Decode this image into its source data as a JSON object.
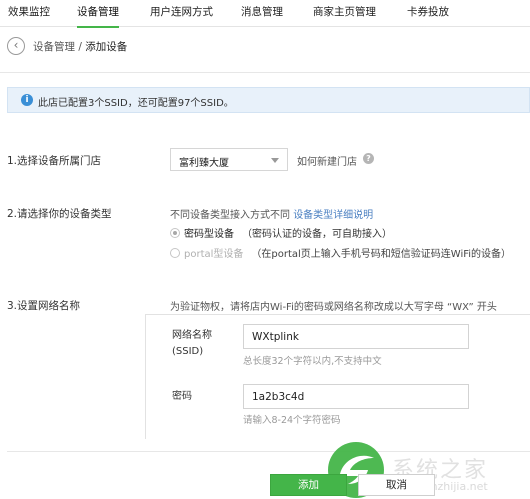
{
  "tabs": [
    {
      "label": "效果监控",
      "active": false
    },
    {
      "label": "设备管理",
      "active": true
    },
    {
      "label": "用户连网方式",
      "active": false
    },
    {
      "label": "消息管理",
      "active": false
    },
    {
      "label": "商家主页管理",
      "active": false
    },
    {
      "label": "卡券投放",
      "active": false
    }
  ],
  "header": {
    "back_glyph": "‹",
    "breadcrumb_parent": "设备管理",
    "breadcrumb_sep": " / ",
    "breadcrumb_current": "添加设备"
  },
  "notice": {
    "icon": "info-icon",
    "icon_glyph": "i",
    "text": "此店已配置3个SSID，还可配置97个SSID。"
  },
  "step1": {
    "label": "1.选择设备所属门店",
    "store_value": "富利臻大厦",
    "new_store_text": "如何新建门店",
    "help_glyph": "?"
  },
  "step2": {
    "label": "2.请选择你的设备类型",
    "desc": "不同设备类型接入方式不同",
    "desc_link": "设备类型详细说明",
    "options": [
      {
        "name": "密码型设备",
        "note": "（密码认证的设备，可自助接入）",
        "checked": true,
        "disabled": false
      },
      {
        "name": "portal型设备",
        "note": "（在portal页上输入手机号码和短信验证码连WiFi的设备）",
        "checked": false,
        "disabled": true
      }
    ]
  },
  "step3": {
    "label": "3.设置网络名称",
    "hint": "为验证物权，请将店内Wi-Fi的密码或网络名称改成以大写字母 “WX” 开头",
    "ssid_label_line1": "网络名称",
    "ssid_label_line2": "(SSID)",
    "ssid_value": "WXtplink",
    "ssid_help": "总长度32个字符以内,不支持中文",
    "password_label": "密码",
    "password_value": "1a2b3c4d",
    "password_help": "请输入8-24个字符密码"
  },
  "actions": {
    "add_label": "添加",
    "cancel_label": "取消"
  },
  "watermark": {
    "text": "系统之家",
    "url": "xitonghzhijia.net"
  },
  "colors": {
    "accent": "#44b549",
    "link": "#4a7fc1",
    "info": "#3a8fd6",
    "notice_bg": "#e8f1fa"
  }
}
